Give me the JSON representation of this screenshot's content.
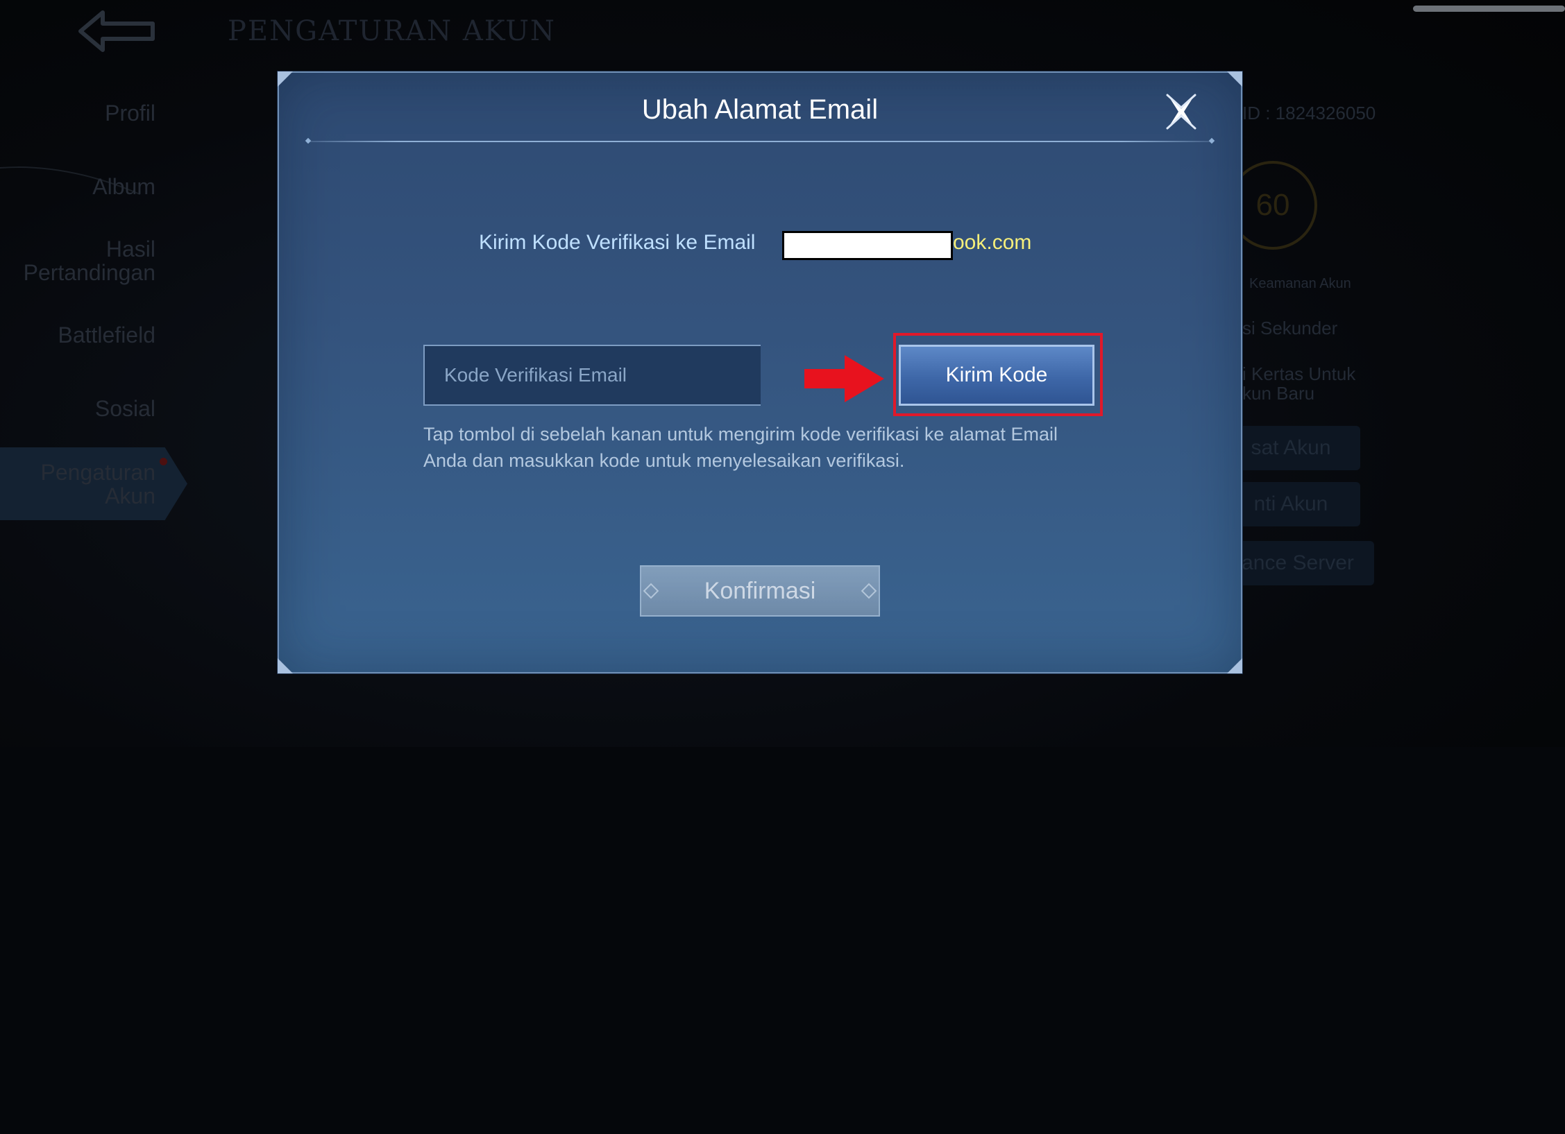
{
  "background": {
    "page_title": "PENGATURAN AKUN",
    "nav": [
      "Profil",
      "Album",
      "Hasil Pertandingan",
      "Battlefield",
      "Sosial",
      "Pengaturan Akun"
    ],
    "right_panel": {
      "id_label": "ID : 1824326050",
      "security_score": "60",
      "security_label": "Keamanan Akun",
      "secondary_label": "si Sekunder",
      "card_label": "i Kertas Untuk",
      "card_label_2": "kun Baru",
      "btn_1": "sat Akun",
      "btn_2": "nti Akun",
      "btn_3": "ance Server"
    }
  },
  "modal": {
    "title": "Ubah Alamat Email",
    "send_label": "Kirim Kode Verifikasi ke Email",
    "email_suffix": "ook.com",
    "code_placeholder": "Kode Verifikasi Email",
    "send_button": "Kirim Kode",
    "help_text": "Tap tombol di sebelah kanan untuk mengirim kode verifikasi ke alamat Email Anda dan masukkan kode untuk menyelesaikan verifikasi.",
    "confirm_button": "Konfirmasi"
  },
  "colors": {
    "annotation_red": "#e0192a",
    "email_yellow": "#f6ef7a",
    "label_blue": "#bfe0ff"
  },
  "icons": {
    "close": "close-icon",
    "back": "back-arrow-icon",
    "annotation": "red-arrow-icon"
  }
}
